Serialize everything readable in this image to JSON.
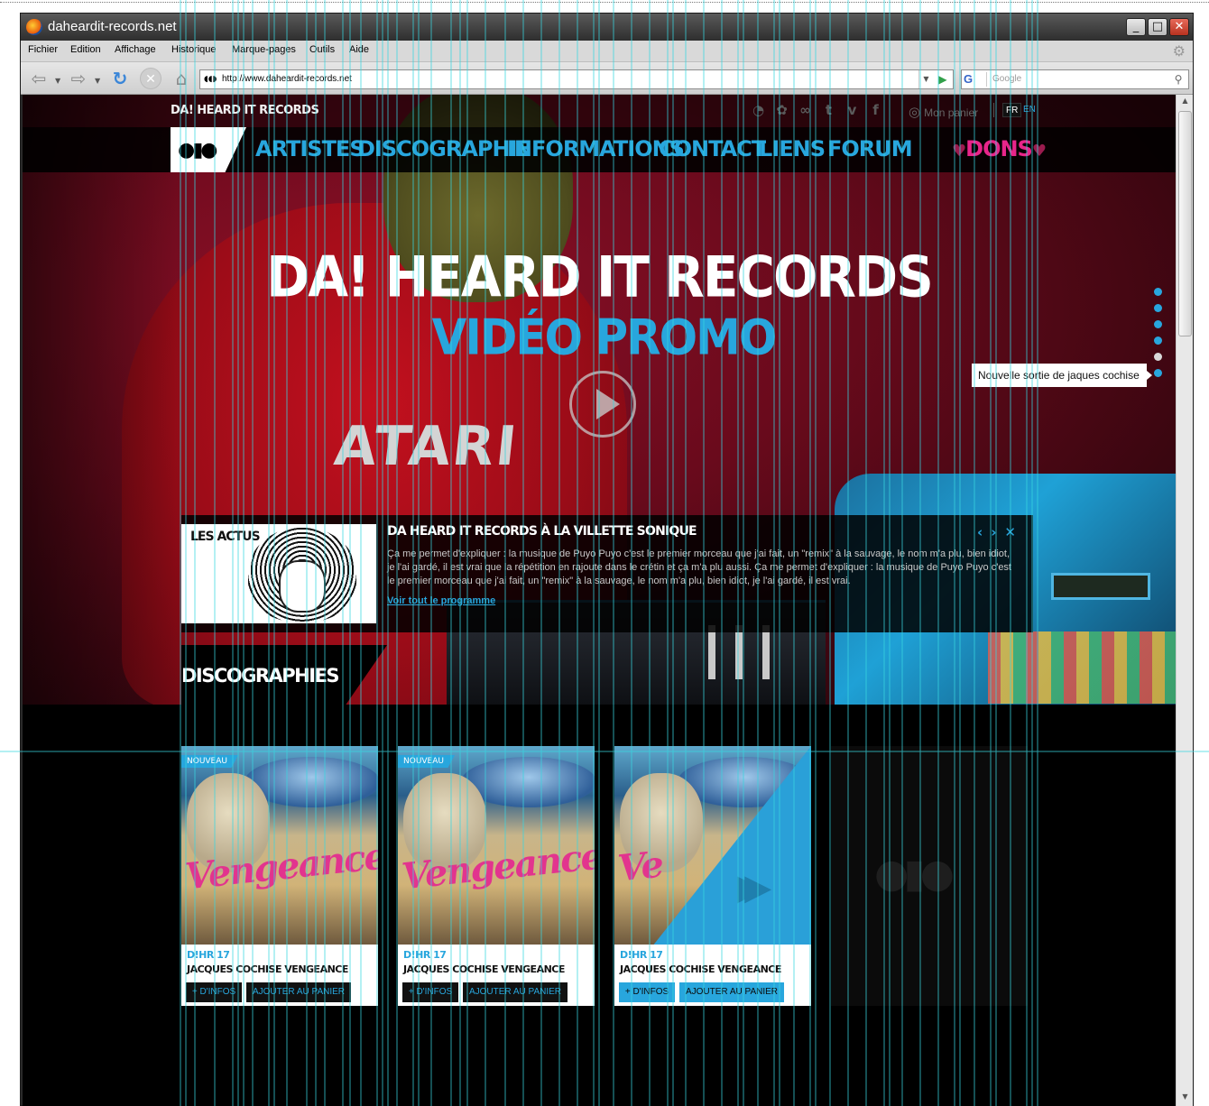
{
  "window": {
    "title": "daheardit-records.net",
    "controls": [
      "_",
      "□",
      "✕"
    ]
  },
  "menu": {
    "items": [
      "Fichier",
      "Edition",
      "Affichage",
      "Historique",
      "Marque-pages",
      "Outils",
      "Aide"
    ]
  },
  "toolbar": {
    "url": "http://www.daheardit-records.net",
    "search_placeholder": "Google",
    "search_engine_letter": "G",
    "icons": [
      "back-icon",
      "forward-icon",
      "reload-icon",
      "stop-icon",
      "home-icon",
      "go-icon",
      "search-icon"
    ]
  },
  "site": {
    "brand": "DA! HEARD IT RECORDS",
    "cart_label": "Mon panier",
    "lang": {
      "fr": "FR",
      "en": "EN"
    },
    "social_icons": [
      "rss-icon",
      "myspace-icon",
      "lastfm-icon",
      "tumblr-icon",
      "vimeo-icon",
      "facebook-icon"
    ],
    "nav": [
      "ARTISTES",
      "DISCOGRAPHIE",
      "INFORMATIONS",
      "CONTACT",
      "LIENS",
      "FORUM"
    ],
    "donate": "DONS"
  },
  "hero": {
    "title": "DA! HEARD IT RECORDS",
    "subtitle": "VIDÉO PROMO",
    "shirt_text": "ATARI",
    "tooltip": "Nouvelle sortie de jaques cochise",
    "slide_count": 6,
    "active_slide": 5
  },
  "news": {
    "tag": "LES ACTUS",
    "title": "DA HEARD IT RECORDS À LA VILLETTE SONIQUE",
    "text": "Ça me permet d'expliquer : la musique de Puyo Puyo c'est le premier morceau que j'ai fait, un \"remix\" à la sauvage, le nom m'a plu, bien idiot, je l'ai gardé, il est vrai que la répétition en rajoute dans le crétin et ça m'a plu aussi. Ça me permet d'expliquer : la musique de Puyo Puyo c'est le premier morceau que j'ai fait, un \"remix\" à la sauvage, le nom m'a plu, bien idiot, je l'ai gardé, il est vrai.",
    "link": "Voir tout le programme",
    "controls": {
      "prev": "‹",
      "next": "›",
      "close": "✕"
    }
  },
  "discographies": {
    "title": "DISCOGRAPHIES",
    "releases": [
      {
        "badge": "NOUVEAU",
        "catalog": "D!HR 17",
        "title": "JACQUES COCHISE VENGEANCE",
        "cover_word": "Vengeance",
        "info_btn": "+ D'INFOS",
        "cart_btn": "AJOUTER AU PANIER"
      },
      {
        "badge": "NOUVEAU",
        "catalog": "D!HR 17",
        "title": "JACQUES COCHISE VENGEANCE",
        "cover_word": "Vengeance",
        "info_btn": "+ D'INFOS",
        "cart_btn": "AJOUTER AU PANIER"
      },
      {
        "badge": "",
        "catalog": "D!HR 17",
        "title": "JACQUES COCHISE VENGEANCE",
        "cover_word": "Ve",
        "info_btn": "+ D'INFOS",
        "cart_btn": "AJOUTER AU PANIER"
      }
    ]
  },
  "colors": {
    "accent_blue": "#28a6dd",
    "donate_pink": "#e8258a",
    "guide_cyan": "#38d6e0",
    "hero_red": "#9c0c18"
  }
}
